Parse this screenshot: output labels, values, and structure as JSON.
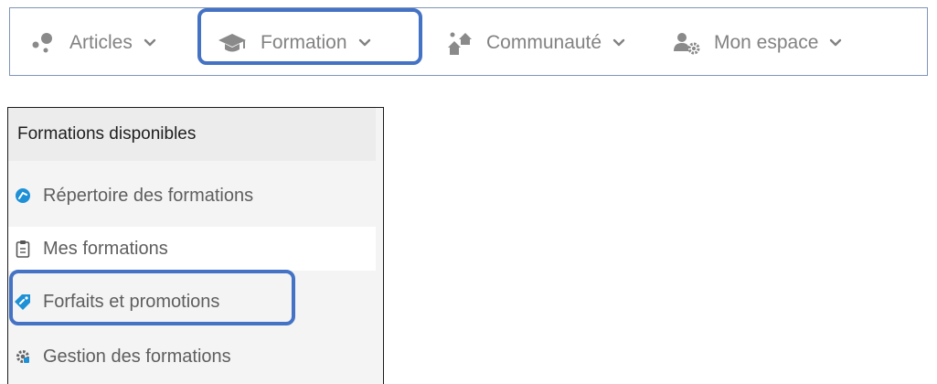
{
  "topnav": {
    "items": [
      {
        "label": "Articles",
        "icon": "dots-icon"
      },
      {
        "label": "Formation",
        "icon": "graduation-cap-icon"
      },
      {
        "label": "Communauté",
        "icon": "community-houses-icon"
      },
      {
        "label": "Mon espace",
        "icon": "user-gear-icon"
      }
    ]
  },
  "sidemenu": {
    "header": "Formations disponibles",
    "items": [
      {
        "label": "Répertoire des formations",
        "icon": "directory-circle-icon"
      },
      {
        "label": "Mes formations",
        "icon": "clipboard-icon"
      },
      {
        "label": "Forfaits et promotions",
        "icon": "tag-link-icon"
      },
      {
        "label": "Gestion des formations",
        "icon": "gear-icon"
      }
    ]
  },
  "colors": {
    "highlight": "#4472c4",
    "nav_text": "#828282",
    "icon_gray": "#8a8a8a",
    "icon_blue": "#1e90d6"
  }
}
